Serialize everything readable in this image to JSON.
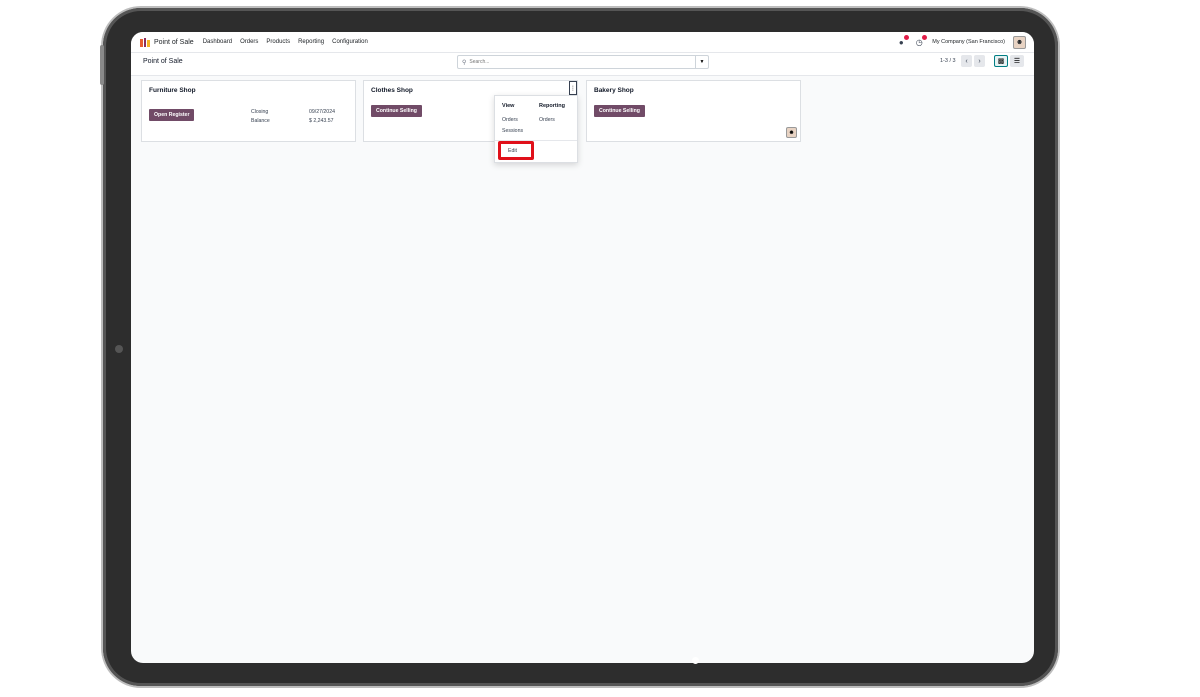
{
  "navbar": {
    "app_name": "Point of Sale",
    "menu": [
      "Dashboard",
      "Orders",
      "Products",
      "Reporting",
      "Configuration"
    ],
    "company": "My Company (San Francisco)",
    "icons": [
      "chat-icon",
      "activity-clock-icon",
      "avatar"
    ]
  },
  "control": {
    "title": "Point of Sale",
    "search_placeholder": "Search...",
    "pager": "1-3 / 3"
  },
  "cards": [
    {
      "name": "Furniture Shop",
      "button": "Open Register",
      "closing_label": "Closing",
      "closing_value": "09/27/2024",
      "balance_label": "Balance",
      "balance_value": "$ 2,243.57"
    },
    {
      "name": "Clothes Shop",
      "button": "Continue Selling"
    },
    {
      "name": "Bakery Shop",
      "button": "Continue Selling"
    }
  ],
  "dropdown": {
    "view_heading": "View",
    "view_items": [
      "Orders",
      "Sessions"
    ],
    "reporting_heading": "Reporting",
    "reporting_items": [
      "Orders"
    ],
    "edit": "Edit"
  },
  "colors": {
    "brand": "#714b67",
    "highlight": "#e0101a",
    "badge": "#e11d48"
  }
}
